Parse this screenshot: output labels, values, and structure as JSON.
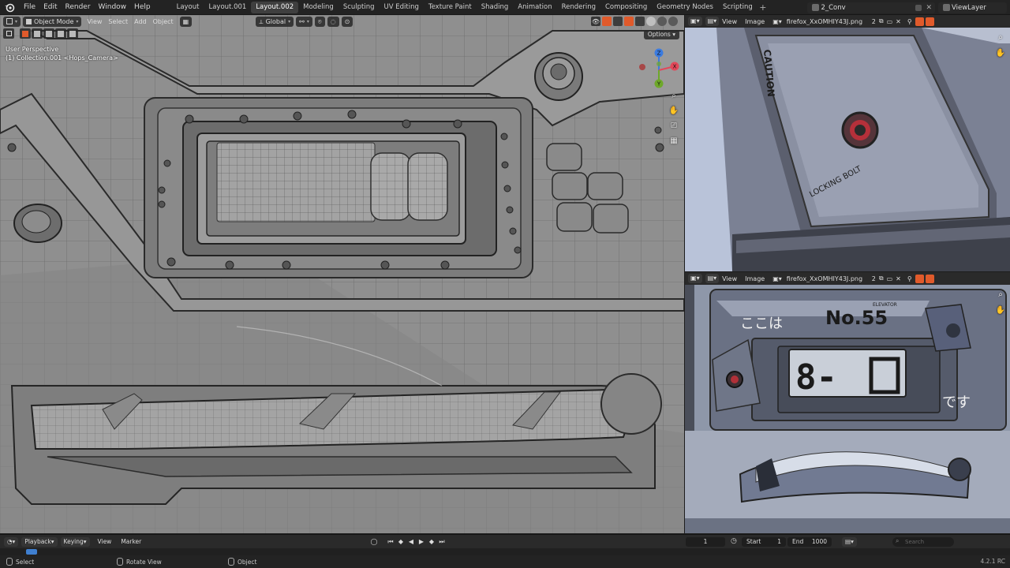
{
  "topbar": {
    "menus": [
      "File",
      "Edit",
      "Render",
      "Window",
      "Help"
    ],
    "workspaces": [
      "Layout",
      "Layout.001",
      "Layout.002",
      "Modeling",
      "Sculpting",
      "UV Editing",
      "Texture Paint",
      "Shading",
      "Animation",
      "Rendering",
      "Compositing",
      "Geometry Nodes",
      "Scripting"
    ],
    "active_workspace": "Layout.002",
    "add_tab": "+",
    "scene_name": "2_Conv",
    "view_layer": "ViewLayer"
  },
  "viewport": {
    "mode": "Object Mode",
    "menus": [
      "View",
      "Select",
      "Add",
      "Object"
    ],
    "transform_orientation": "Global",
    "options_label": "Options",
    "info_line1": "User Perspective",
    "info_line2": "(1) Collection.001 <Hops_Camera>",
    "gizmo_axes": [
      "X",
      "Y",
      "Z"
    ],
    "colors": {
      "x_axis": "#e2485a",
      "y_axis": "#6ea82a",
      "z_axis": "#3b7be0",
      "accent": "#e05a2b"
    }
  },
  "image_editor_top": {
    "menu_view": "View",
    "menu_image": "Image",
    "image_name": "firefox_XxOMHIY43J.png",
    "user_count": "2",
    "caution_text": "CAUTION",
    "locking_text": "LOCKING BOLT"
  },
  "image_editor_bottom": {
    "menu_view": "View",
    "menu_image": "Image",
    "image_name": "firefox_XxOMHIY43J.png",
    "user_count": "2",
    "kokoha_text": "ここは",
    "number_text": "No.55",
    "elevator_text": "ELEVATOR",
    "desu_text": "です",
    "display_text": "8-"
  },
  "timeline": {
    "playback": "Playback",
    "keying": "Keying",
    "view": "View",
    "marker": "Marker",
    "current_frame": "1",
    "start_label": "Start",
    "start_value": "1",
    "end_label": "End",
    "end_value": "1000",
    "search_placeholder": "Search"
  },
  "statusbar": {
    "select": "Select",
    "rotate_view": "Rotate View",
    "object": "Object",
    "version": "4.2.1 RC"
  }
}
